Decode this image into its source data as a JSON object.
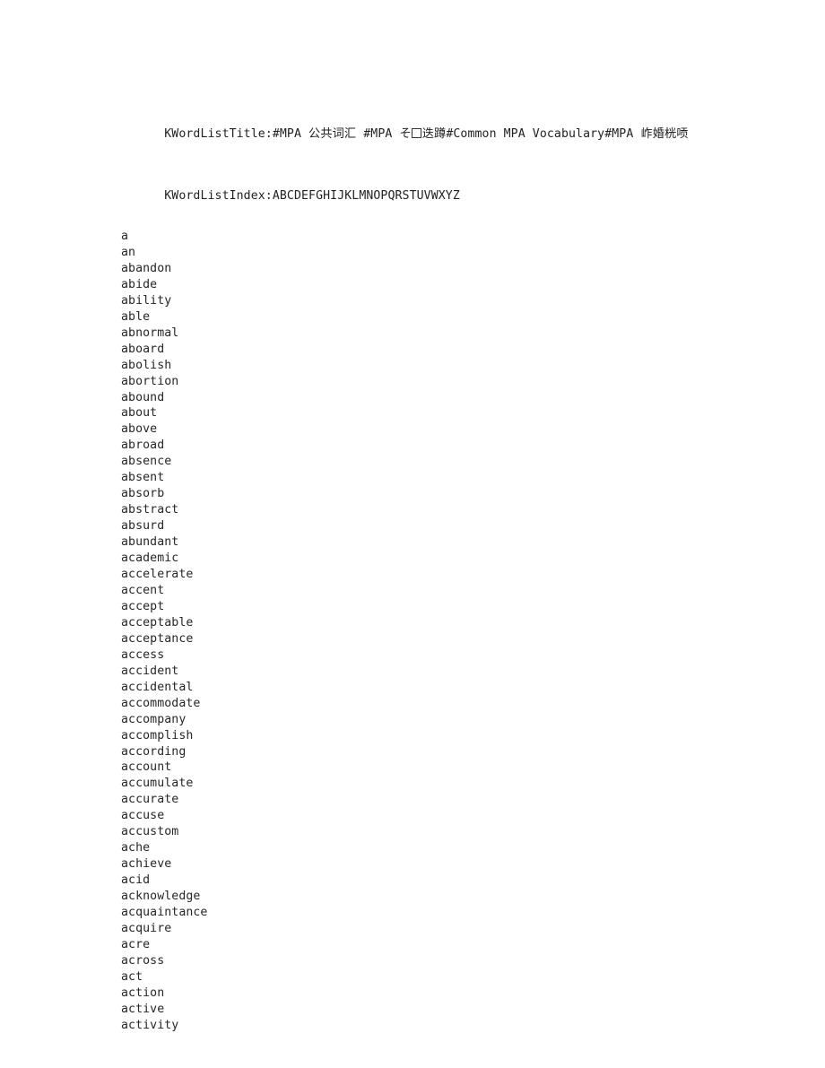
{
  "document": {
    "title_line": {
      "key": "KWordListTitle:",
      "segments": [
        {
          "type": "text",
          "value": "#MPA "
        },
        {
          "type": "cjk",
          "value": "公共词汇"
        },
        {
          "type": "text",
          "value": " #MPA "
        },
        {
          "type": "cjk",
          "value": "そ"
        },
        {
          "type": "tofu",
          "value": "□"
        },
        {
          "type": "cjk",
          "value": "迭蹲"
        },
        {
          "type": "text",
          "value": "#Common MPA Vocabulary#MPA "
        },
        {
          "type": "cjk",
          "value": "岞婚桄唝"
        }
      ],
      "full_text": "KWordListTitle:#MPA 公共词汇 #MPA そ□迭蹲#Common MPA Vocabulary#MPA 岞婚桄唝"
    },
    "index_line": {
      "key": "KWordListIndex:",
      "letters": "ABCDEFGHIJKLMNOPQRSTUVWXYZ",
      "full_text": "KWordListIndex:ABCDEFGHIJKLMNOPQRSTUVWXYZ"
    },
    "words": [
      "a",
      "an",
      "abandon",
      "abide",
      "ability",
      "able",
      "abnormal",
      "aboard",
      "abolish",
      "abortion",
      "abound",
      "about",
      "above",
      "abroad",
      "absence",
      "absent",
      "absorb",
      "abstract",
      "absurd",
      "abundant",
      "academic",
      "accelerate",
      "accent",
      "accept",
      "acceptable",
      "acceptance",
      "access",
      "accident",
      "accidental",
      "accommodate",
      "accompany",
      "accomplish",
      "according",
      "account",
      "accumulate",
      "accurate",
      "accuse",
      "accustom",
      "ache",
      "achieve",
      "acid",
      "acknowledge",
      "acquaintance",
      "acquire",
      "acre",
      "across",
      "act",
      "action",
      "active",
      "activity"
    ]
  },
  "colors": {
    "page_background": "#ffffff",
    "text": "#262626",
    "heading_text": "#222222"
  }
}
